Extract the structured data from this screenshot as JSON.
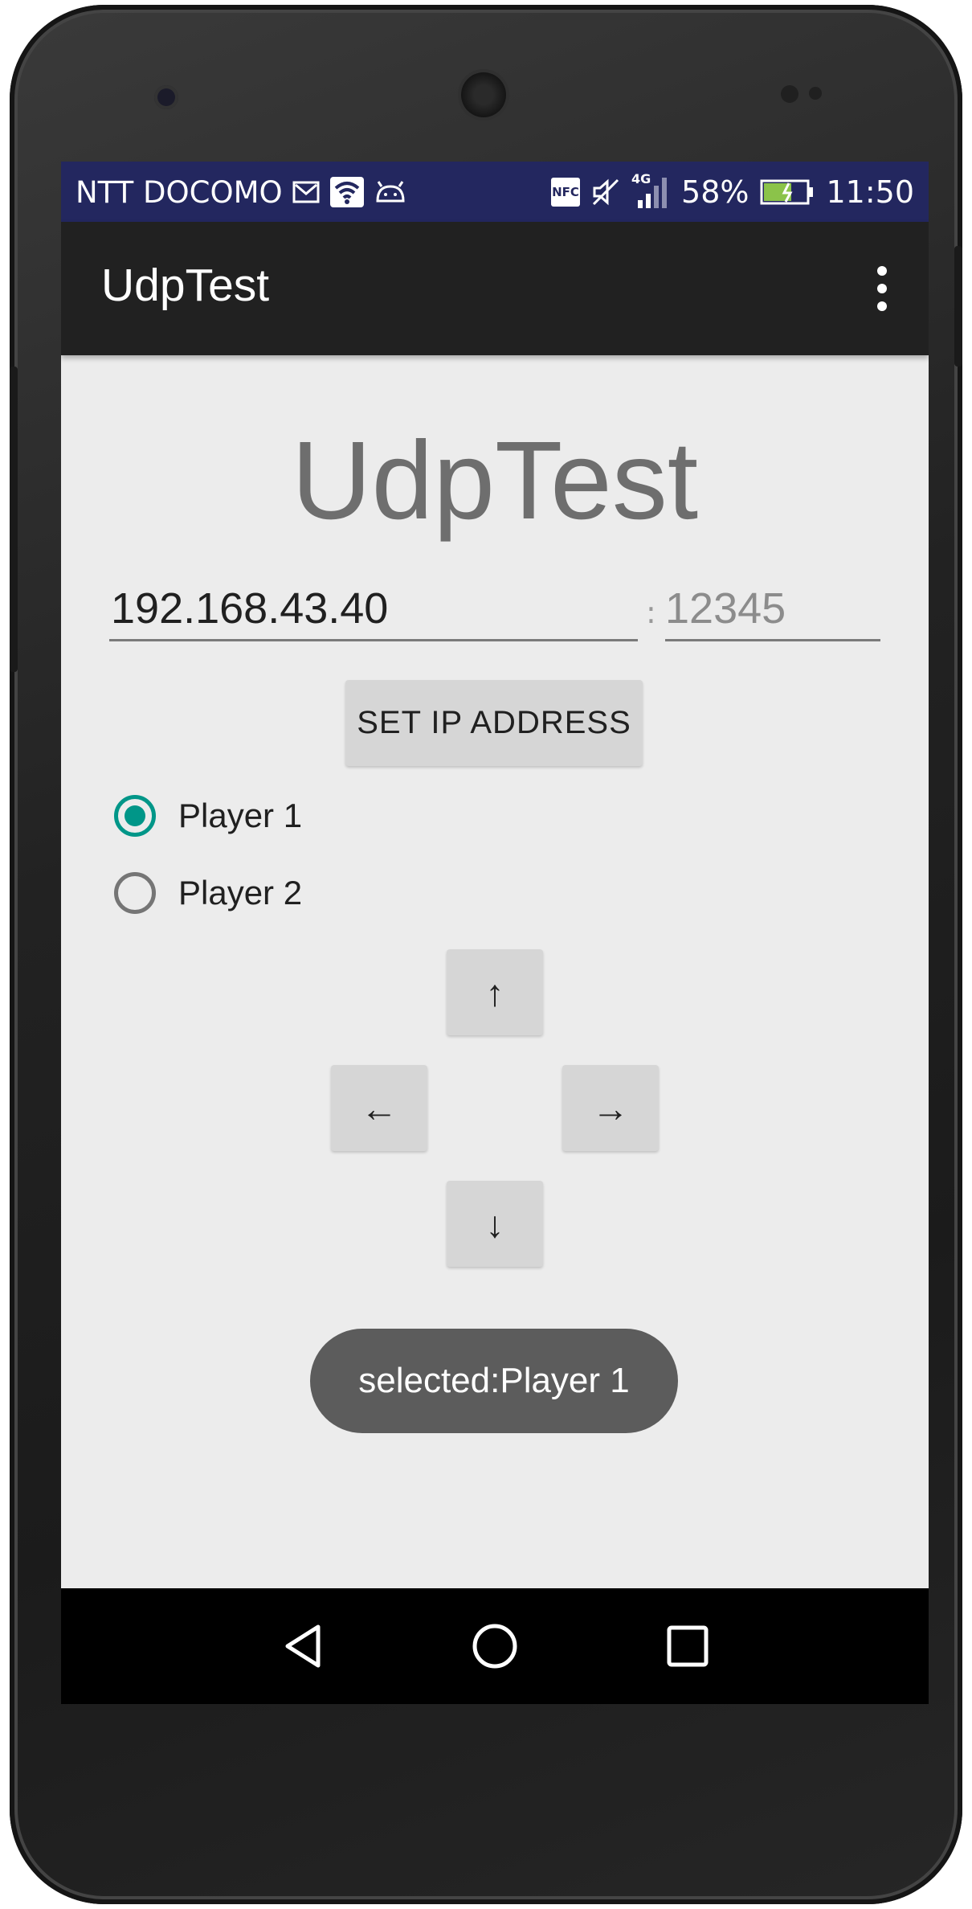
{
  "status_bar": {
    "carrier": "NTT DOCOMO",
    "battery_percent": "58%",
    "time": "11:50",
    "network_type": "4G",
    "left_icons": [
      "mail-icon",
      "wifi-icon",
      "android-icon"
    ],
    "right_icons": [
      "nfc-icon",
      "mute-icon",
      "signal-icon",
      "battery-icon"
    ],
    "nfc_label": "NFC",
    "background_color": "#23275f"
  },
  "app_bar": {
    "title": "UdpTest",
    "menu_icon": "overflow-menu-icon",
    "background_color": "#212121"
  },
  "main": {
    "title": "UdpTest",
    "ip_address_value": "192.168.43.40",
    "port_separator": ":",
    "port_placeholder": "12345",
    "set_ip_button_label": "SET IP ADDRESS",
    "players": [
      {
        "label": "Player 1",
        "checked": true
      },
      {
        "label": "Player 2",
        "checked": false
      }
    ],
    "dpad": {
      "up": "↑",
      "left": "←",
      "right": "→",
      "down": "↓"
    },
    "accent_color": "#009688"
  },
  "toast": {
    "text": "selected:Player 1"
  },
  "nav_bar": {
    "buttons": [
      "back-icon",
      "home-icon",
      "recents-icon"
    ]
  }
}
